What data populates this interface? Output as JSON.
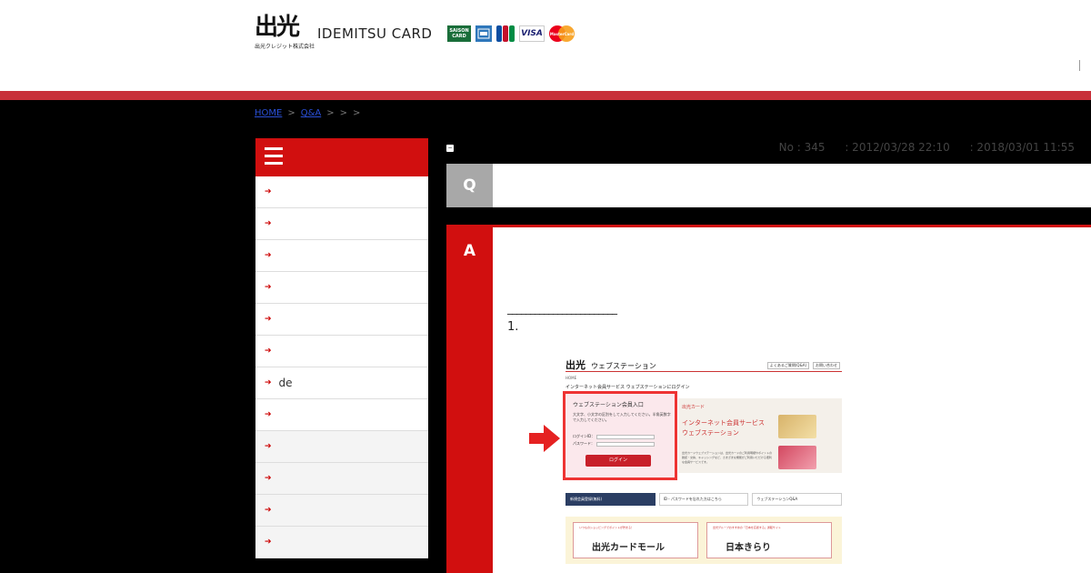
{
  "header": {
    "logo_kanji": "出光",
    "logo_sub": "出光クレジット株式会社",
    "brand_name": "IDEMITSU CARD",
    "card_logos": [
      "SAISON CARD",
      "AMEX",
      "JCB",
      "VISA",
      "MasterCard"
    ],
    "card_saison_l1": "SAISON",
    "card_saison_l2": "CARD",
    "card_visa": "VISA",
    "card_master": "MasterCard"
  },
  "colors": {
    "header_red_bar": "#c8303a",
    "accent_red": "#d10f0f",
    "q_gray": "#a8a8a8",
    "background": "#000000"
  },
  "breadcrumb": {
    "home": "HOME",
    "sep1": ">",
    "qa": "Q&A",
    "sep2": ">",
    "sep3": ">",
    "sep4": ">"
  },
  "sidebar": {
    "menu_icon": "hamburger-icon",
    "items": [
      {
        "label": ""
      },
      {
        "label": ""
      },
      {
        "label": ""
      },
      {
        "label": ""
      },
      {
        "label": ""
      },
      {
        "label": ""
      },
      {
        "label": "de"
      },
      {
        "label": ""
      },
      {
        "label": ""
      },
      {
        "label": ""
      },
      {
        "label": ""
      },
      {
        "label": ""
      }
    ]
  },
  "main": {
    "meta": {
      "no": "No : 345",
      "created": ": 2012/03/28 22:10",
      "updated": ": 2018/03/01 11:55"
    },
    "q_label": "Q",
    "a_label": "A",
    "a_line": "________________________",
    "a_step": "1."
  },
  "embed": {
    "kanji": "出光",
    "title": "ウェブステーション",
    "links": [
      "よくあるご質問(Q&A)",
      "お問い合わせ"
    ],
    "crumb": "HOME",
    "sub": "インターネット会員サービス ウェブステーションにログイン",
    "login_title": "ウェブステーション会員入口",
    "login_desc": "大文字、小文字の区別をして入力してください。半角英数字で入力してください。",
    "login_id": "ログインID：",
    "password": "パスワード：",
    "login_button": "ログイン",
    "banner_top": "出光カード",
    "banner_main": "インターネット会員サービス ウェブステーション",
    "banner_note": "出光カードウェブステーションは、出光カードのご利用明細やポイントの確認・交換、キャッシングなど、さまざまな機能がご利用いただける便利な会員サービスです。",
    "nav": [
      "新規会員登録(無料)",
      "ID・パスワードを忘れた方はこちら",
      "ウェブステーションQ&A"
    ],
    "ad1_small": "いつものショッピングでポイントが貯まる！",
    "ad1": "出光カードモール",
    "ad2_small": "出光グループおすすめの「日本を応援する」通販サイト",
    "ad2": "日本きらり"
  }
}
